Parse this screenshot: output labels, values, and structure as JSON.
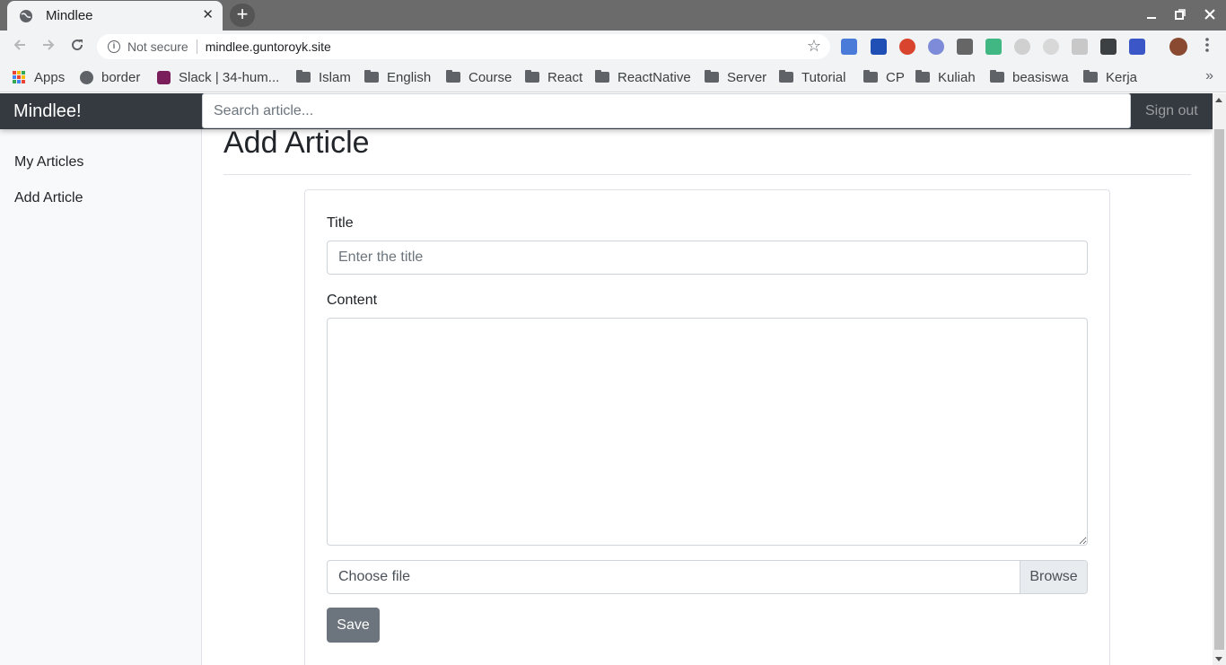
{
  "browser": {
    "tab_title": "Mindlee",
    "tab_close": "✕",
    "new_tab": "+",
    "security_text": "Not secure",
    "url": "mindlee.guntoroyk.site",
    "bookmarks": [
      "Apps",
      "border",
      "Slack | 34-hum...",
      "Islam",
      "English",
      "Course",
      "React",
      "ReactNative",
      "Server",
      "Tutorial",
      "CP",
      "Kuliah",
      "beasiswa",
      "Kerja"
    ],
    "bookmarks_overflow": "»"
  },
  "navbar": {
    "brand": "Mindlee!",
    "search_placeholder": "Search article...",
    "signout": "Sign out"
  },
  "sidebar": {
    "items": [
      {
        "label": "My Articles"
      },
      {
        "label": "Add Article"
      }
    ]
  },
  "main": {
    "page_title": "Add Article",
    "form": {
      "title_label": "Title",
      "title_placeholder": "Enter the title",
      "content_label": "Content",
      "content_value": "",
      "file_text": "Choose file",
      "browse_label": "Browse",
      "save_label": "Save"
    }
  },
  "colors": {
    "navbar_bg": "#343a40",
    "save_button": "#6c757d",
    "sidebar_bg": "#f8f9fa"
  }
}
